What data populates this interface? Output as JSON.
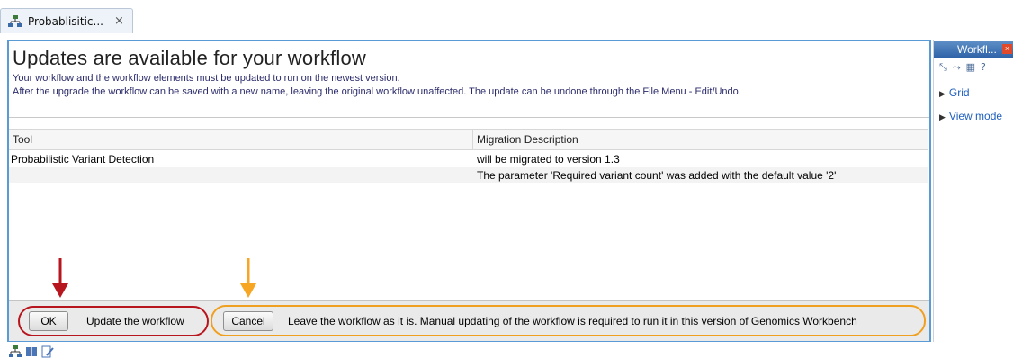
{
  "tab": {
    "title": "Probablisitic...",
    "close_glyph": "×",
    "icon": "workflow-icon"
  },
  "header": {
    "title": "Updates are available for your workflow",
    "line1": "Your workflow and the workflow elements must be updated to run on the newest version.",
    "line2": "After the upgrade the workflow can be saved with a new name, leaving the original workflow unaffected. The update can be undone through the File Menu - Edit/Undo."
  },
  "table": {
    "columns": [
      "Tool",
      "Migration Description"
    ],
    "rows": [
      [
        "Probabilistic Variant Detection",
        "will be migrated to version 1.3"
      ],
      [
        "",
        "The parameter 'Required variant count' was added with the default value '2'"
      ]
    ]
  },
  "footer": {
    "ok_label": "OK",
    "ok_desc": "Update the workflow",
    "cancel_label": "Cancel",
    "cancel_desc": "Leave the workflow as it is. Manual updating of the workflow is required to run it in this version of Genomics Workbench"
  },
  "side_panel": {
    "title": "Workfl...",
    "tool_icons": [
      "connect-icon",
      "disconnect-icon",
      "layout-icon",
      "help-icon"
    ],
    "items": [
      {
        "label": "Grid"
      },
      {
        "label": "View mode"
      }
    ]
  },
  "colors": {
    "accent_blue": "#5b9bd5",
    "highlight_red": "#b8161e",
    "highlight_orange": "#f0a020",
    "arrow_red": "#b8161e",
    "arrow_orange": "#f6a623"
  }
}
